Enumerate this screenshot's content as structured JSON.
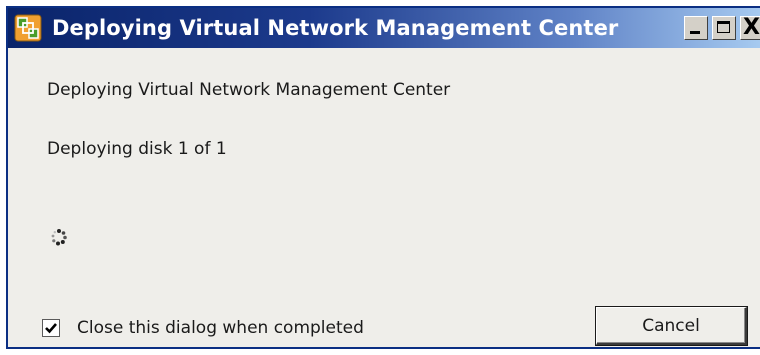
{
  "window": {
    "title": "Deploying Virtual Network Management Center",
    "close_glyph": "X"
  },
  "content": {
    "heading": "Deploying Virtual Network Management Center",
    "status": "Deploying disk 1 of 1"
  },
  "footer": {
    "close_when_completed_label": "Close this dialog when completed",
    "close_when_completed_checked": true,
    "cancel_label": "Cancel"
  },
  "icons": {
    "app": "vsphere-app-icon",
    "minimize": "minimize-icon",
    "maximize": "maximize-icon",
    "close": "close-icon",
    "spinner": "loading-spinner-icon",
    "checkmark": "checkmark-icon"
  },
  "colors": {
    "titlebar_start": "#0a246a",
    "titlebar_end": "#a6caf0",
    "dialog_background": "#efeeea",
    "app_icon_green": "#4a9d2a",
    "app_icon_orange": "#f0a030"
  }
}
